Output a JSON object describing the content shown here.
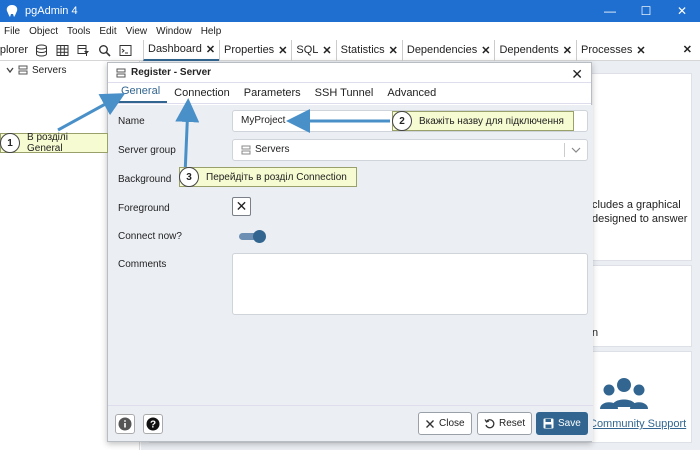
{
  "window": {
    "title": "pgAdmin 4"
  },
  "menu": [
    "File",
    "Object",
    "Tools",
    "Edit",
    "View",
    "Window",
    "Help"
  ],
  "toolbar": {
    "explorer_label": "Object Explorer"
  },
  "main_tabs": [
    {
      "label": "Dashboard",
      "active": true
    },
    {
      "label": "Properties"
    },
    {
      "label": "SQL"
    },
    {
      "label": "Statistics"
    },
    {
      "label": "Dependencies"
    },
    {
      "label": "Dependents"
    },
    {
      "label": "Processes"
    }
  ],
  "tree": {
    "servers_label": "Servers"
  },
  "background": {
    "fragment1": "cludes a graphical",
    "fragment2": "designed to answer",
    "fragment3": "n",
    "community_support": "Community Support"
  },
  "dialog": {
    "title": "Register - Server",
    "tabs": [
      "General",
      "Connection",
      "Parameters",
      "SSH Tunnel",
      "Advanced"
    ],
    "active_tab": "General",
    "fields": {
      "name_label": "Name",
      "name_value": "MyProject",
      "server_group_label": "Server group",
      "server_group_value": "Servers",
      "background_label": "Background",
      "foreground_label": "Foreground",
      "connect_now_label": "Connect now?",
      "connect_now_value": true,
      "comments_label": "Comments",
      "comments_value": ""
    },
    "buttons": {
      "close": "Close",
      "reset": "Reset",
      "save": "Save"
    }
  },
  "callouts": [
    {
      "number": "1",
      "text": "В розділі General"
    },
    {
      "number": "2",
      "text": "Вкажіть назву для підключення"
    },
    {
      "number": "3",
      "text": "Перейдіть в розділ Connection"
    }
  ],
  "colors": {
    "title_bar": "#1f6fd1",
    "accent": "#326690",
    "callout_bg": "#f6fbd1",
    "arrow": "#4a90c8"
  }
}
